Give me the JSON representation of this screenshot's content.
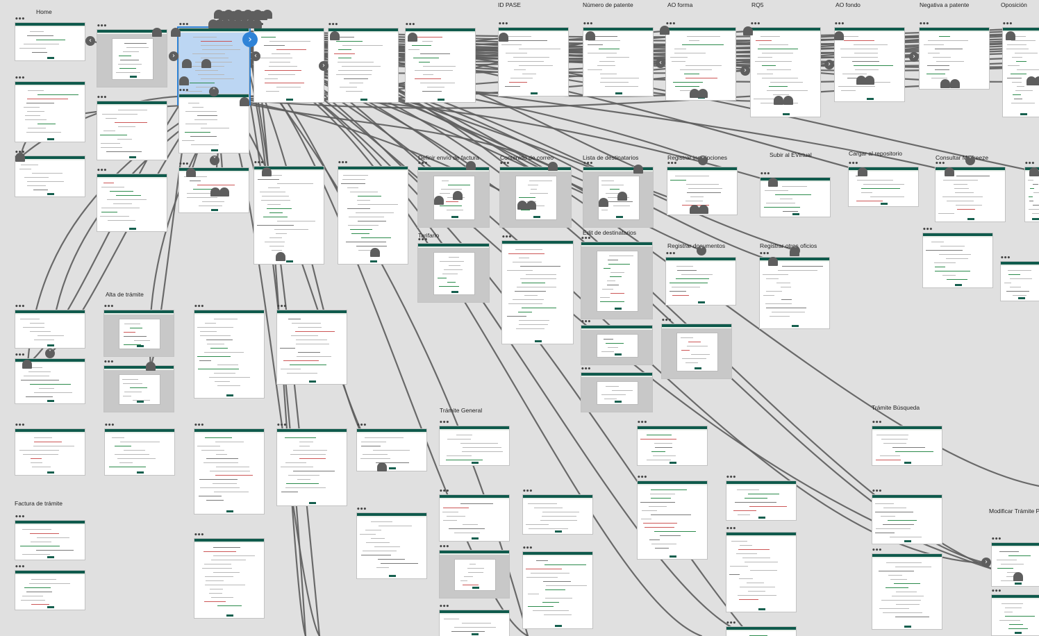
{
  "canvas": {
    "background": "#e0e0e0",
    "artboard_header_color": "#0f5a4c",
    "wire_color": "#5e5e5e",
    "selection_color": "#2f83d7"
  },
  "group_labels": [
    "Home",
    "ID PASE",
    "Número de patente",
    "AO forma",
    "RQ5",
    "AO fondo",
    "Negativa a patente",
    "Oposición",
    "Definir envío de factura",
    "Contenido de correo",
    "Lista de destinatarios",
    "Registrar inscripciones",
    "Subir al EVirtual",
    "Cargar al repositorio",
    "Consultar Minfreeze",
    "Tarifario",
    "Edit de destinatarios",
    "Registrar documentos",
    "Registrar otros oficios",
    "Alta de trámite",
    "Trámite General",
    "Trámite Búsqueda",
    "Modificar Trámite P",
    "Factura de trámite"
  ],
  "artboard_menu_glyph": "•••",
  "connector_icons": {
    "right": "chevron-right-icon",
    "left": "chevron-left-icon",
    "up": "chevron-up-icon",
    "down": "chevron-down-icon"
  },
  "glyphs": {
    "right": "›",
    "left": "‹",
    "up": "˄",
    "down": "˅"
  }
}
